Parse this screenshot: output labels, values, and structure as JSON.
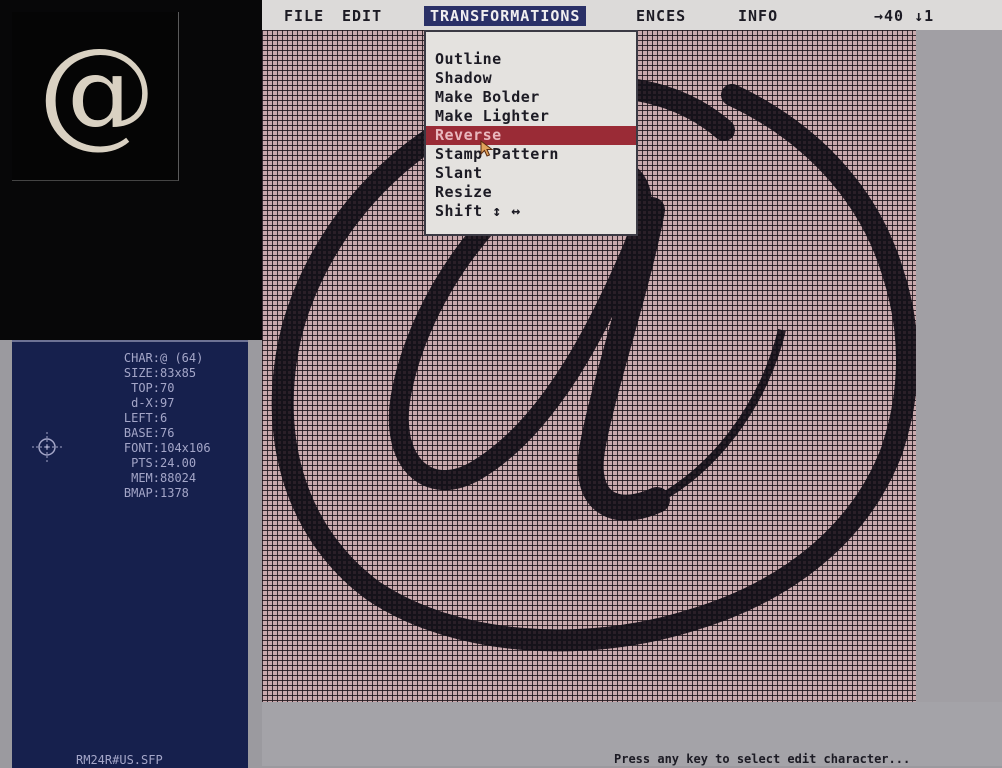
{
  "menu": {
    "file": "FILE",
    "edit": "EDIT",
    "transformations": "TRANSFORMATIONS",
    "preferences_partial": "ENCES",
    "info": "INFO",
    "position_indicator": "→40 ↓1"
  },
  "preview": {
    "glyph": "@"
  },
  "transformations_menu": {
    "items": [
      {
        "label": "Outline"
      },
      {
        "label": "Shadow"
      },
      {
        "label": "Make Bolder"
      },
      {
        "label": "Make Lighter"
      },
      {
        "label": "Reverse"
      },
      {
        "label": "Stamp Pattern"
      },
      {
        "label": "Slant"
      },
      {
        "label": "Resize"
      },
      {
        "label": "Shift ↕ ↔"
      }
    ],
    "selected_index": 4
  },
  "char_info": {
    "rows": [
      {
        "key": "CHAR:",
        "value": "@ (64)"
      },
      {
        "key": "SIZE:",
        "value": "83x85"
      },
      {
        "key": "TOP:",
        "value": "70"
      },
      {
        "key": "d-X:",
        "value": "97"
      },
      {
        "key": "LEFT:",
        "value": "6"
      },
      {
        "key": "BASE:",
        "value": "76"
      },
      {
        "key": "FONT:",
        "value": "104x106"
      },
      {
        "key": "PTS:",
        "value": "24.00"
      },
      {
        "key": "MEM:",
        "value": "88024"
      },
      {
        "key": "BMAP:",
        "value": "1378"
      }
    ],
    "crosshair_icon": "crosshair-icon"
  },
  "font_file": "RM24R#US.SFP",
  "status": "Press any key to select edit character...",
  "colors": {
    "grid_background": "#c9a9ad",
    "info_panel": "#16204d",
    "menu_highlight": "#2a3067",
    "menu_selected_item": "#9a2b36"
  }
}
